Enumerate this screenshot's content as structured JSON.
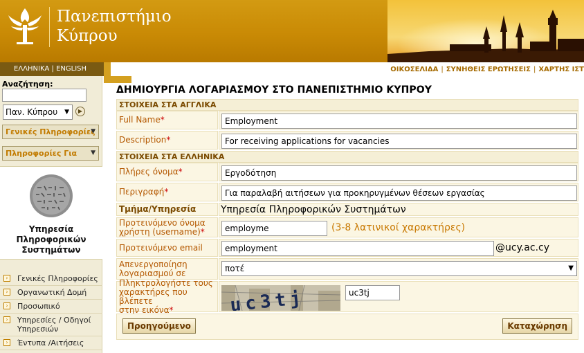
{
  "header": {
    "logo_line1": "Πανεπιστήμιο",
    "logo_line2": "Κύπρου"
  },
  "lang_bar": {
    "greek": "ΕΛΛΗΝΙΚΑ",
    "sep": "|",
    "english": "ENGLISH"
  },
  "top_links": [
    "ΟΙΚΟΣΕΛΙΔΑ",
    "ΣΥΝΗΘΕΙΣ ΕΡΩΤΗΣΕΙΣ",
    "ΧΑΡΤΗΣ ΙΣΤ"
  ],
  "sidebar": {
    "search_label": "Αναζήτηση:",
    "search_value": "",
    "scope_value": "Παν. Κύπρου",
    "menu_general": "Γενικές Πληροφορίες",
    "menu_info_for": "Πληροφορίες Για",
    "unit_name_line1": "Υπηρεσία",
    "unit_name_line2": "Πληροφορικών",
    "unit_name_line3": "Συστημάτων",
    "nav": [
      "Γενικές Πληροφορίες",
      "Οργανωτική Δομή",
      "Προσωπικό",
      "Υπηρεσίες / Οδηγοί Υπηρεσιών",
      "Έντυπα /Αιτήσεις"
    ]
  },
  "page_title": "ΔΗΜΙΟΥΡΓΙΑ ΛΟΓΑΡΙΑΣΜΟΥ ΣΤΟ ΠΑΝΕΠΙΣΤΗΜΙΟ ΚΥΠΡΟΥ",
  "form": {
    "section_english": "ΣΤΟΙΧΕΙΑ ΣΤΑ ΑΓΓΛΙΚΑ",
    "full_name_label": "Full Name",
    "full_name_value": "Employment",
    "description_label": "Description",
    "description_value": "For receiving applications for vacancies",
    "section_greek": "ΣΤΟΙΧΕΙΑ ΣΤΑ ΕΛΛΗΝΙΚΑ",
    "full_name_gr_label": "Πλήρες όνομα",
    "full_name_gr_value": "Εργοδότηση",
    "description_gr_label": "Περιγραφή",
    "description_gr_value": "Για παραλαβή αιτήσεων για προκηρυγμένων θέσεων εργασίας",
    "department_label": "Τμήμα/Υπηρεσία",
    "department_value": "Υπηρεσία Πληροφορικών Συστημάτων",
    "username_label_line1": "Προτεινόμενο όνομα",
    "username_label_line2": "χρήστη (username)",
    "username_value": "employme",
    "username_hint": "(3-8 λατινικοί χαρακτήρες)",
    "email_label": "Προτεινόμενο email",
    "email_value": "employment",
    "email_domain": "@ucy.ac.cy",
    "deactivate_label_line1": "Απενεργοποίηση",
    "deactivate_label_line2": "λογαριασμού σε",
    "deactivate_value": "ποτέ",
    "captcha_label_line1": "Πληκτρολογήστε τους",
    "captcha_label_line2": "χαρακτήρες που βλέπετε",
    "captcha_label_line3": "στην εικόνα",
    "captcha_text": "uc3tj",
    "captcha_value": "uc3tj",
    "required_mark": "*"
  },
  "buttons": {
    "previous": "Προηγούμενο",
    "submit": "Καταχώρηση"
  },
  "colors": {
    "header_gold": "#c98a05",
    "label_orange": "#b45800",
    "required_red": "#cc0000"
  }
}
